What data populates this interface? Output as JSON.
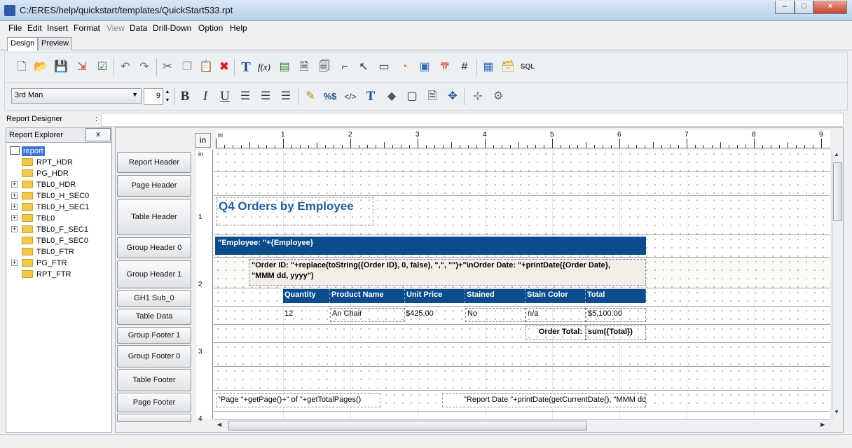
{
  "window": {
    "title": "C:/ERES/help/quickstart/templates/QuickStart533.rpt",
    "controls": [
      "–",
      "□",
      "×"
    ]
  },
  "menu": [
    "File",
    "Edit",
    "Insert",
    "Format",
    "View",
    "Data",
    "Drill-Down",
    "Option",
    "Help"
  ],
  "tabs": [
    "Design",
    "Preview"
  ],
  "toolbar": {
    "font": "3rd Man",
    "font_size": "9"
  },
  "report_designer": {
    "label": "Report Designer",
    "colon": ":"
  },
  "explorer": {
    "title": "Report Explorer",
    "close": "x",
    "root": "report",
    "nodes": [
      "RPT_HDR",
      "PG_HDR",
      "TBL0_HDR",
      "TBL0_H_SEC0",
      "TBL0_H_SEC1",
      "TBL0",
      "TBL0_F_SEC1",
      "TBL0_F_SEC0",
      "TBL0_FTR",
      "PG_FTR",
      "RPT_FTR"
    ]
  },
  "sections": [
    "Report Header",
    "Page Header",
    "Table Header",
    "Group Header 0",
    "Group Header 1",
    "GH1 Sub_0",
    "Table Data",
    "Group Footer 1",
    "Group Footer 0",
    "Table Footer",
    "Page Footer"
  ],
  "ruler": {
    "unit": "in",
    "h_marks": [
      "1",
      "2",
      "3",
      "4",
      "5",
      "6",
      "7",
      "8",
      "9"
    ],
    "v_marks": [
      "1",
      "2",
      "3",
      "4"
    ]
  },
  "design": {
    "title": "Q4 Orders by Employee",
    "employee_field": "\"Employee: \"+{Employee}",
    "order_expr_line1": "\"Order ID: \"+replace(toString({Order ID}, 0, false), \",\", \"\")+\"\\nOrder Date: \"+printDate({Order Date},",
    "order_expr_line2": "\"MMM dd, yyyy\")",
    "columns": [
      "Quantity",
      "Product Name",
      "Unit Price",
      "Stained",
      "Stain Color",
      "Total"
    ],
    "row": [
      "12",
      "An Chair",
      "$425.00",
      "No",
      "n/a",
      "$5,100.00"
    ],
    "order_total_label": "Order Total:",
    "order_total_value": "sum({Total})",
    "page_expr": "\"Page \"+getPage()+\" of \"+getTotalPages()",
    "report_date_expr": "\"Report Date \"+printDate(getCurrentDate(), \"MMM dd,"
  },
  "colors": {
    "header_blue": "#0b4d8c",
    "title_blue": "#1f5f9e",
    "group_bg": "#f3efe8"
  }
}
